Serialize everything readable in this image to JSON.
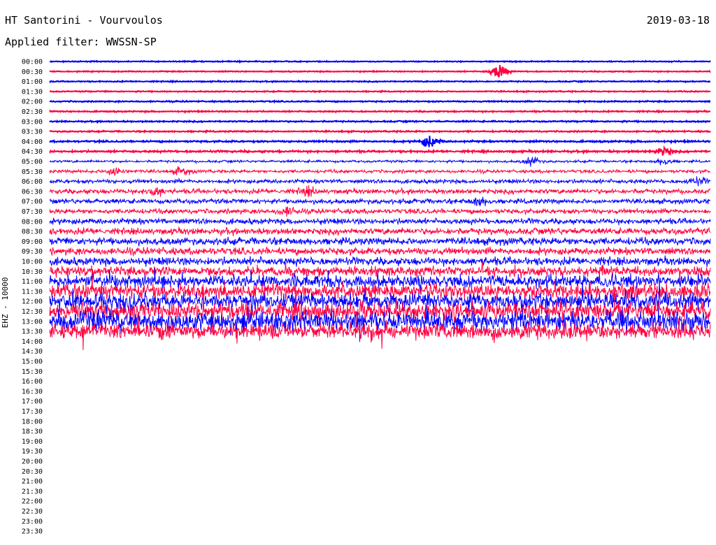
{
  "header": {
    "title": "HT Santorini - Vourvoulos",
    "date": "2019-03-18",
    "filter": "Applied filter: WWSSN-SP"
  },
  "chart_data": {
    "type": "line",
    "title": "HT Santorini - Vourvoulos",
    "ylabel": "EHZ - 10000",
    "xlabel": "",
    "row_labels": [
      "00:00",
      "00:30",
      "01:00",
      "01:30",
      "02:00",
      "02:30",
      "03:00",
      "03:30",
      "04:00",
      "04:30",
      "05:00",
      "05:30",
      "06:00",
      "06:30",
      "07:00",
      "07:30",
      "08:00",
      "08:30",
      "09:00",
      "09:30",
      "10:00",
      "10:30",
      "11:00",
      "11:30",
      "12:00",
      "12:30",
      "13:00",
      "13:30",
      "14:00",
      "14:30",
      "15:00",
      "15:30",
      "16:00",
      "16:30",
      "17:00",
      "17:30",
      "18:00",
      "18:30",
      "19:00",
      "19:30",
      "20:00",
      "20:30",
      "21:00",
      "21:30",
      "22:00",
      "22:30",
      "23:00",
      "23:30"
    ],
    "series_colors": [
      "#0000ff",
      "#ff0040"
    ],
    "last_row_recorded": "14:00",
    "row_amplitude_levels": [
      1.2,
      1.2,
      1.3,
      1.3,
      1.5,
      1.5,
      1.6,
      1.6,
      2,
      2.2,
      3,
      4,
      5,
      6,
      6,
      6,
      7,
      8,
      9,
      9,
      10,
      12,
      16,
      18,
      20,
      22,
      24,
      20,
      0,
      0,
      0,
      0,
      0,
      0,
      0,
      0,
      0,
      0,
      0,
      0,
      0,
      0,
      0,
      0,
      0,
      0,
      0,
      0
    ],
    "events": [
      {
        "row": "00:30",
        "x_fraction": 0.68,
        "amplitude": 14
      },
      {
        "row": "04:00",
        "x_fraction": 0.575,
        "amplitude": 12
      },
      {
        "row": "05:00",
        "x_fraction": 0.73,
        "amplitude": 8
      },
      {
        "row": "05:00",
        "x_fraction": 0.93,
        "amplitude": 6
      },
      {
        "row": "04:30",
        "x_fraction": 0.93,
        "amplitude": 8
      },
      {
        "row": "05:30",
        "x_fraction": 0.1,
        "amplitude": 10
      },
      {
        "row": "05:30",
        "x_fraction": 0.2,
        "amplitude": 8
      },
      {
        "row": "06:30",
        "x_fraction": 0.16,
        "amplitude": 8
      },
      {
        "row": "06:30",
        "x_fraction": 0.39,
        "amplitude": 7
      },
      {
        "row": "07:30",
        "x_fraction": 0.36,
        "amplitude": 8
      },
      {
        "row": "07:00",
        "x_fraction": 0.65,
        "amplitude": 8
      },
      {
        "row": "06:00",
        "x_fraction": 0.98,
        "amplitude": 7
      }
    ]
  }
}
